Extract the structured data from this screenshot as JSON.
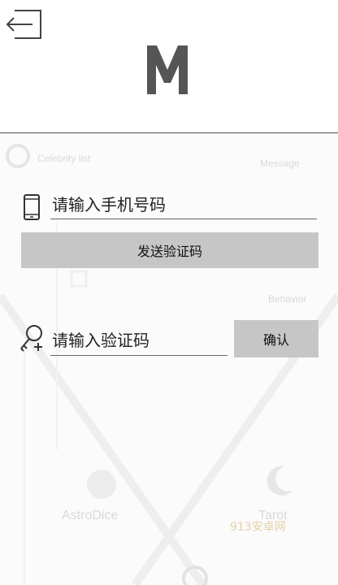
{
  "header": {
    "back_icon": "exit-arrow-icon",
    "logo_letter": "M"
  },
  "login": {
    "phone_placeholder": "请输入手机号码",
    "send_code_label": "发送验证码",
    "code_placeholder": "请输入验证码",
    "confirm_label": "确认"
  },
  "icons": {
    "phone": "phone-icon",
    "key": "key-icon"
  },
  "colors": {
    "button_bg": "#c6c6c6",
    "logo": "#555555",
    "divider": "#555555"
  },
  "watermark": "913安卓网"
}
